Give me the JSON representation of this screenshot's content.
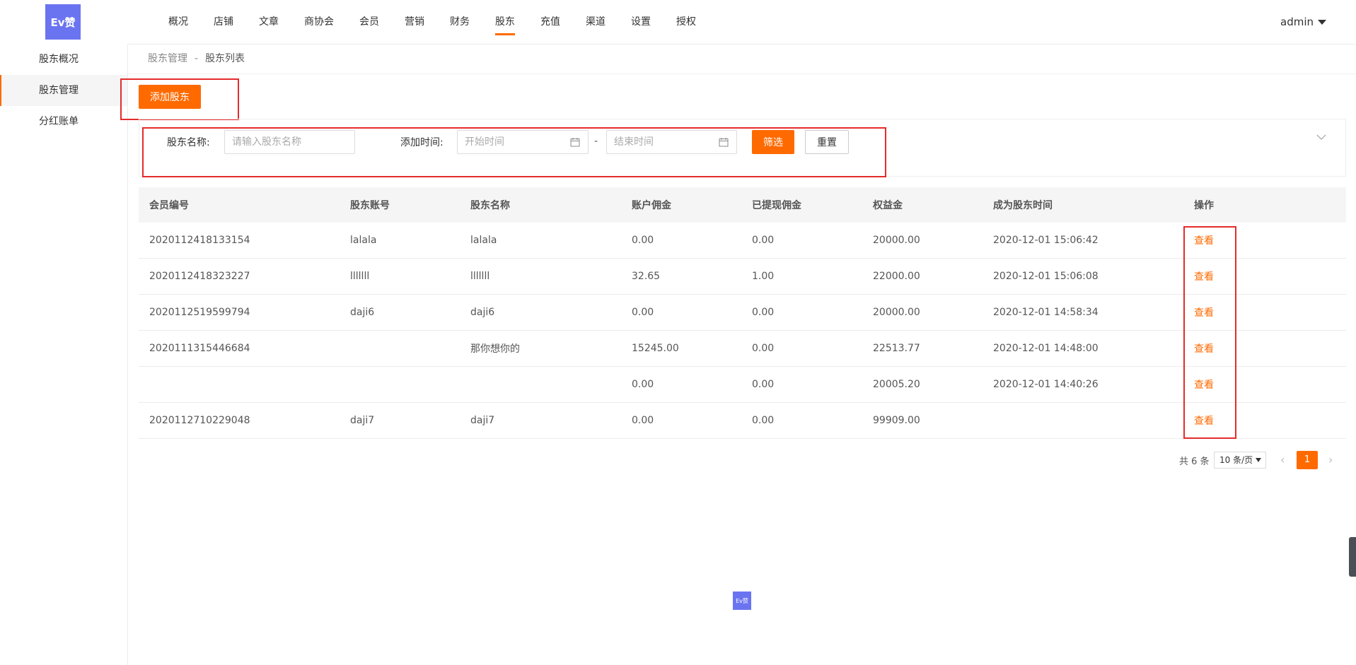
{
  "brand": {
    "logo_text": "Ev赞"
  },
  "nav": {
    "items": [
      "概况",
      "店铺",
      "文章",
      "商协会",
      "会员",
      "营销",
      "财务",
      "股东",
      "充值",
      "渠道",
      "设置",
      "授权"
    ],
    "active": "股东",
    "user": "admin"
  },
  "sidebar": {
    "items": [
      "股东概况",
      "股东管理",
      "分红账单"
    ],
    "active": "股东管理"
  },
  "breadcrumb": {
    "parent": "股东管理",
    "separator": "-",
    "current": "股东列表"
  },
  "actions": {
    "add_label": "添加股东"
  },
  "filter": {
    "name_label": "股东名称:",
    "name_placeholder": "请输入股东名称",
    "time_label": "添加时间:",
    "start_placeholder": "开始时间",
    "range_separator": "-",
    "end_placeholder": "结束时间",
    "filter_label": "筛选",
    "reset_label": "重置"
  },
  "table": {
    "columns": [
      "会员编号",
      "股东账号",
      "股东名称",
      "账户佣金",
      "已提现佣金",
      "权益金",
      "成为股东时间",
      "操作"
    ],
    "action_label": "查看",
    "rows": [
      [
        "2020112418133154",
        "lalala",
        "lalala",
        "0.00",
        "0.00",
        "20000.00",
        "2020-12-01 15:06:42"
      ],
      [
        "2020112418323227",
        "lllllll",
        "lllllll",
        "32.65",
        "1.00",
        "22000.00",
        "2020-12-01 15:06:08"
      ],
      [
        "2020112519599794",
        "daji6",
        "daji6",
        "0.00",
        "0.00",
        "20000.00",
        "2020-12-01 14:58:34"
      ],
      [
        "2020111315446684",
        "",
        "那你想你的",
        "15245.00",
        "0.00",
        "22513.77",
        "2020-12-01 14:48:00"
      ],
      [
        "",
        "",
        "",
        "0.00",
        "0.00",
        "20005.20",
        "2020-12-01 14:40:26"
      ],
      [
        "2020112710229048",
        "daji7",
        "daji7",
        "0.00",
        "0.00",
        "99909.00",
        ""
      ]
    ]
  },
  "pagination": {
    "total_text": "共 6 条",
    "page_size": "10 条/页",
    "current_page": "1",
    "prev": "‹",
    "next": "›"
  },
  "colors": {
    "accent": "#ff6a00",
    "highlight_box": "#e52b2b",
    "brand": "#6b74f0"
  }
}
